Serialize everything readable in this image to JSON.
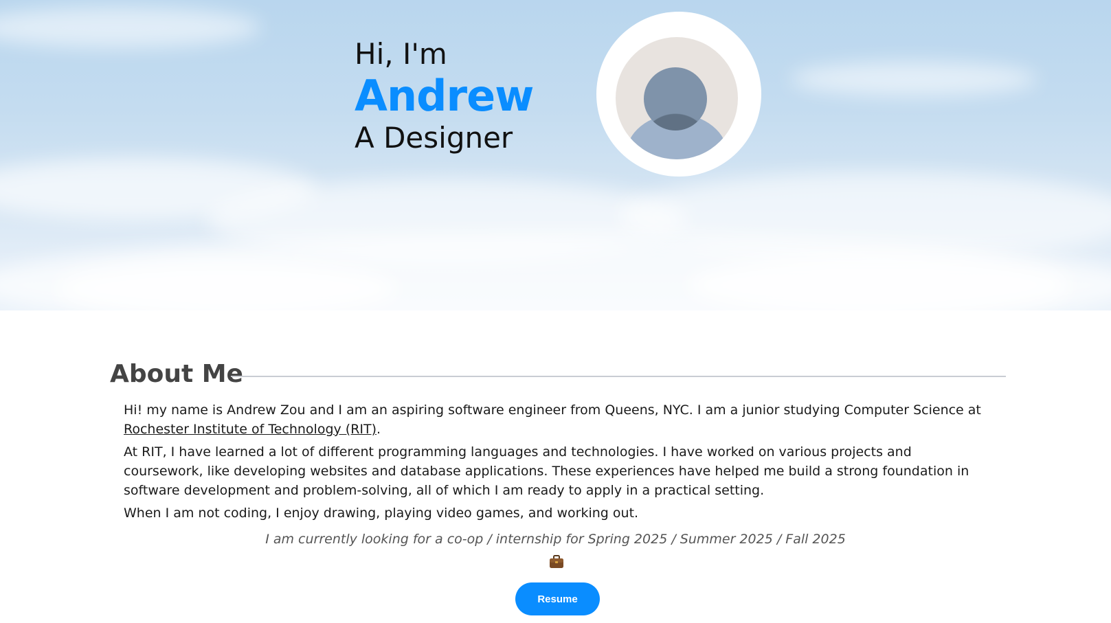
{
  "hero": {
    "greeting": "Hi, I'm",
    "name": "Andrew",
    "role": "A Designer",
    "name_color": "#0a8dff"
  },
  "avatar": {
    "icon": "user-avatar-icon"
  },
  "about": {
    "title": "About Me",
    "p1_before_link": "Hi! my name is Andrew Zou and I am an aspiring software engineer from Queens, NYC. I am a junior studying Computer Science at ",
    "p1_link": "Rochester Institute of Technology (RIT)",
    "p1_after_link": ".",
    "p2": "At RIT, I have learned a lot of different programming languages and technologies. I have worked on various projects and coursework, like developing websites and database applications. These experiences have helped me build a strong foundation in software development and problem-solving, all of which I am ready to apply in a practical setting.",
    "p3": "When I am not coding, I enjoy drawing, playing video games, and working out.",
    "cta_note": "I am currently looking for a co-op / internship for Spring 2025 / Summer 2025 / Fall 2025",
    "cta_icon": "briefcase-icon",
    "resume_label": "Resume",
    "accent_color": "#0a8dff"
  }
}
